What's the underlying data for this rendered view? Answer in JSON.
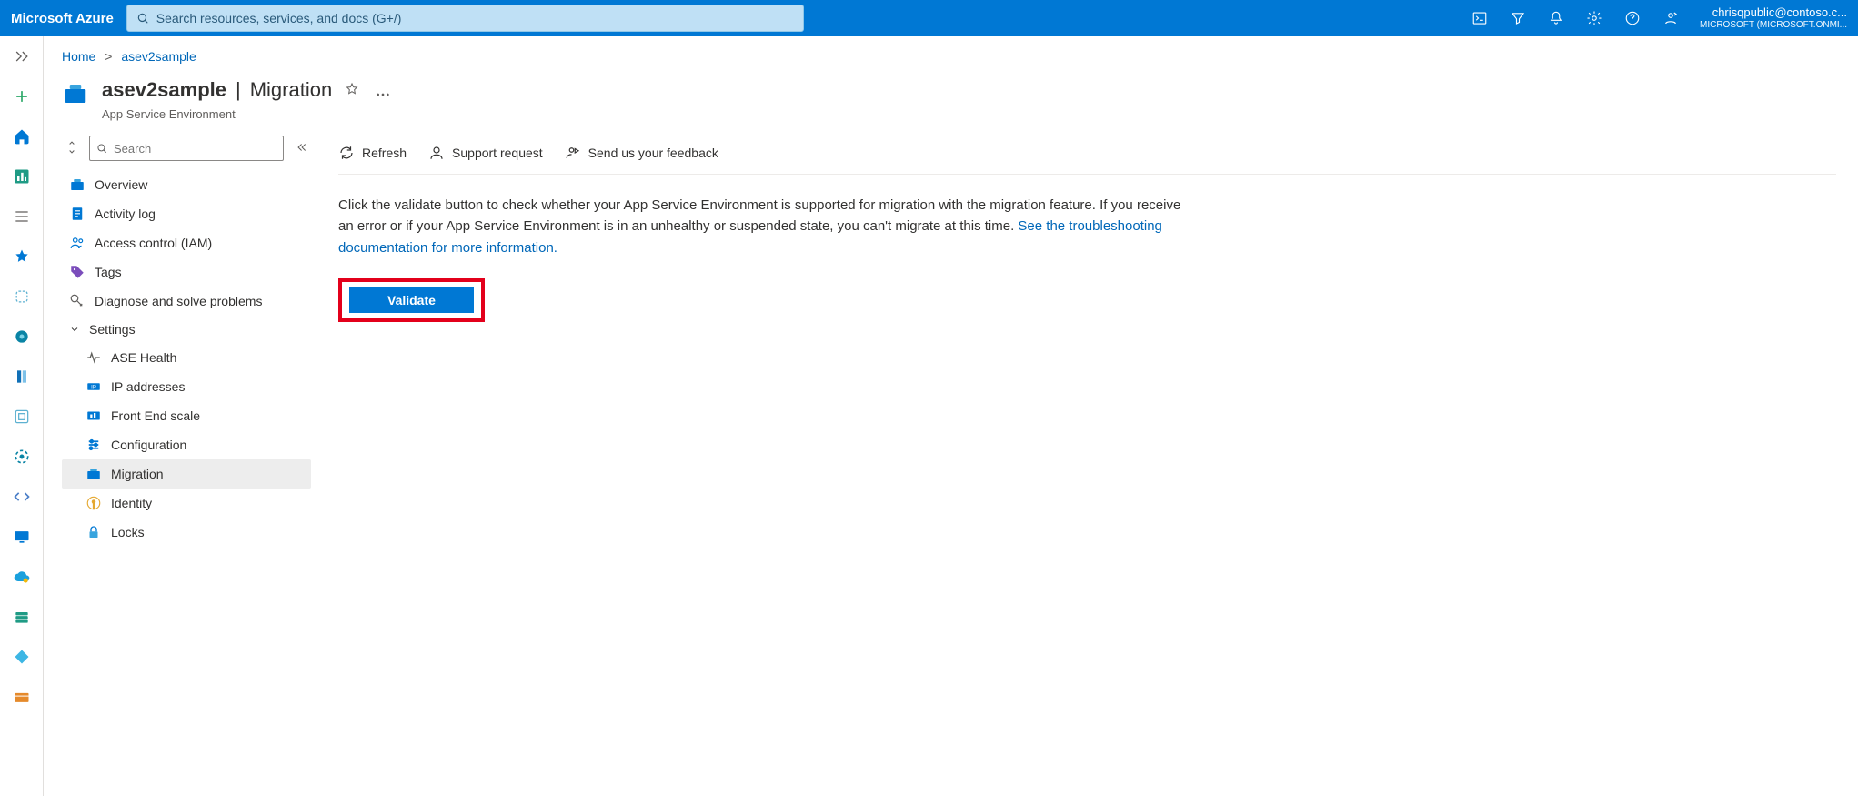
{
  "brand": "Microsoft Azure",
  "search": {
    "placeholder": "Search resources, services, and docs (G+/)"
  },
  "account": {
    "email": "chrisqpublic@contoso.c...",
    "tenant": "MICROSOFT (MICROSOFT.ONMI..."
  },
  "breadcrumbs": {
    "home": "Home",
    "resource": "asev2sample"
  },
  "blade": {
    "title_name": "asev2sample",
    "title_section": "Migration",
    "subtitle": "App Service Environment",
    "search_placeholder": "Search"
  },
  "nav": {
    "overview": "Overview",
    "activity_log": "Activity log",
    "access_control": "Access control (IAM)",
    "tags": "Tags",
    "diagnose": "Diagnose and solve problems",
    "settings_header": "Settings",
    "ase_health": "ASE Health",
    "ip_addresses": "IP addresses",
    "front_end_scale": "Front End scale",
    "configuration": "Configuration",
    "migration": "Migration",
    "identity": "Identity",
    "locks": "Locks"
  },
  "commands": {
    "refresh": "Refresh",
    "support": "Support request",
    "feedback": "Send us your feedback"
  },
  "content": {
    "description": "Click the validate button to check whether your App Service Environment is supported for migration with the migration feature. If you receive an error or if your App Service Environment is in an unhealthy or suspended state, you can't migrate at this time. ",
    "doc_link": "See the troubleshooting documentation for more information.",
    "validate_button": "Validate"
  }
}
